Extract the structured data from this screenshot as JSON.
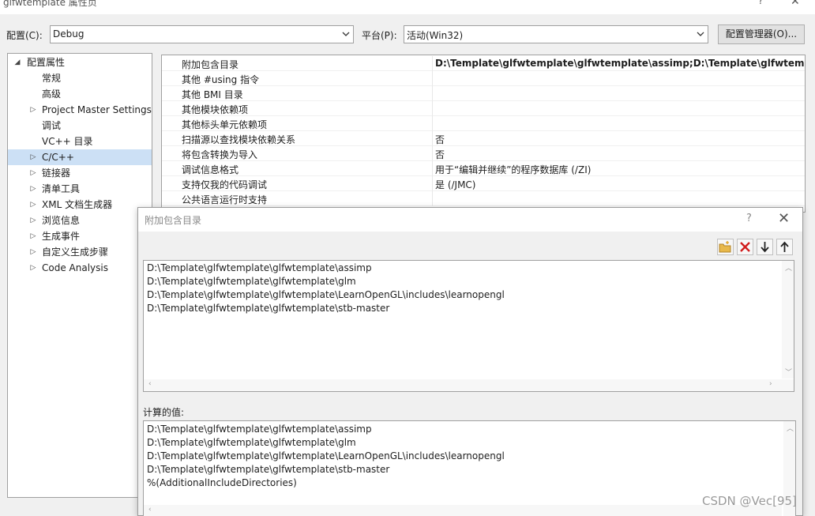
{
  "window": {
    "title": "glfwtemplate 属性页",
    "help_label": "?",
    "close_label": "✕"
  },
  "toolbar": {
    "config_label": "配置(C):",
    "config_value": "Debug",
    "platform_label": "平台(P):",
    "platform_value": "活动(Win32)",
    "config_manager_label": "配置管理器(O)..."
  },
  "tree": {
    "items": [
      {
        "label": "配置属性",
        "expander": "◢"
      },
      {
        "label": "常规",
        "expander": ""
      },
      {
        "label": "高级",
        "expander": ""
      },
      {
        "label": "Project Master Settings",
        "expander": "▷"
      },
      {
        "label": "调试",
        "expander": ""
      },
      {
        "label": "VC++ 目录",
        "expander": ""
      },
      {
        "label": "C/C++",
        "expander": "▷"
      },
      {
        "label": "链接器",
        "expander": "▷"
      },
      {
        "label": "清单工具",
        "expander": "▷"
      },
      {
        "label": "XML 文档生成器",
        "expander": "▷"
      },
      {
        "label": "浏览信息",
        "expander": "▷"
      },
      {
        "label": "生成事件",
        "expander": "▷"
      },
      {
        "label": "自定义生成步骤",
        "expander": "▷"
      },
      {
        "label": "Code Analysis",
        "expander": "▷"
      }
    ]
  },
  "grid": {
    "rows": [
      {
        "name": "附加包含目录",
        "value": "D:\\Template\\glfwtemplate\\glfwtemplate\\assimp;D:\\Template\\glfwtemplate\\glfwtemplate\\glm"
      },
      {
        "name": "其他 #using 指令",
        "value": ""
      },
      {
        "name": "其他 BMI 目录",
        "value": ""
      },
      {
        "name": "其他模块依赖项",
        "value": ""
      },
      {
        "name": "其他标头单元依赖项",
        "value": ""
      },
      {
        "name": "扫描源以查找模块依赖关系",
        "value": "否"
      },
      {
        "name": "将包含转换为导入",
        "value": "否"
      },
      {
        "name": "调试信息格式",
        "value": "用于“编辑并继续”的程序数据库 (/ZI)"
      },
      {
        "name": "支持仅我的代码调试",
        "value": "是 (/JMC)"
      },
      {
        "name": "公共语言运行时支持",
        "value": ""
      }
    ]
  },
  "dialog": {
    "title": "附加包含目录",
    "help_label": "?",
    "close_label": "✕",
    "entries": [
      "D:\\Template\\glfwtemplate\\glfwtemplate\\assimp",
      "D:\\Template\\glfwtemplate\\glfwtemplate\\glm",
      "D:\\Template\\glfwtemplate\\glfwtemplate\\LearnOpenGL\\includes\\learnopengl",
      "D:\\Template\\glfwtemplate\\glfwtemplate\\stb-master"
    ],
    "computed_label": "计算的值:",
    "computed": [
      "D:\\Template\\glfwtemplate\\glfwtemplate\\assimp",
      "D:\\Template\\glfwtemplate\\glfwtemplate\\glm",
      "D:\\Template\\glfwtemplate\\glfwtemplate\\LearnOpenGL\\includes\\learnopengl",
      "D:\\Template\\glfwtemplate\\glfwtemplate\\stb-master",
      "%(AdditionalIncludeDirectories)"
    ],
    "tools": [
      "new-folder-icon",
      "delete-icon",
      "move-down-icon",
      "move-up-icon"
    ]
  },
  "watermark": "CSDN @Vec[95]",
  "colors": {
    "selection": "#cce0f5",
    "delete_red": "#d11c1c"
  }
}
